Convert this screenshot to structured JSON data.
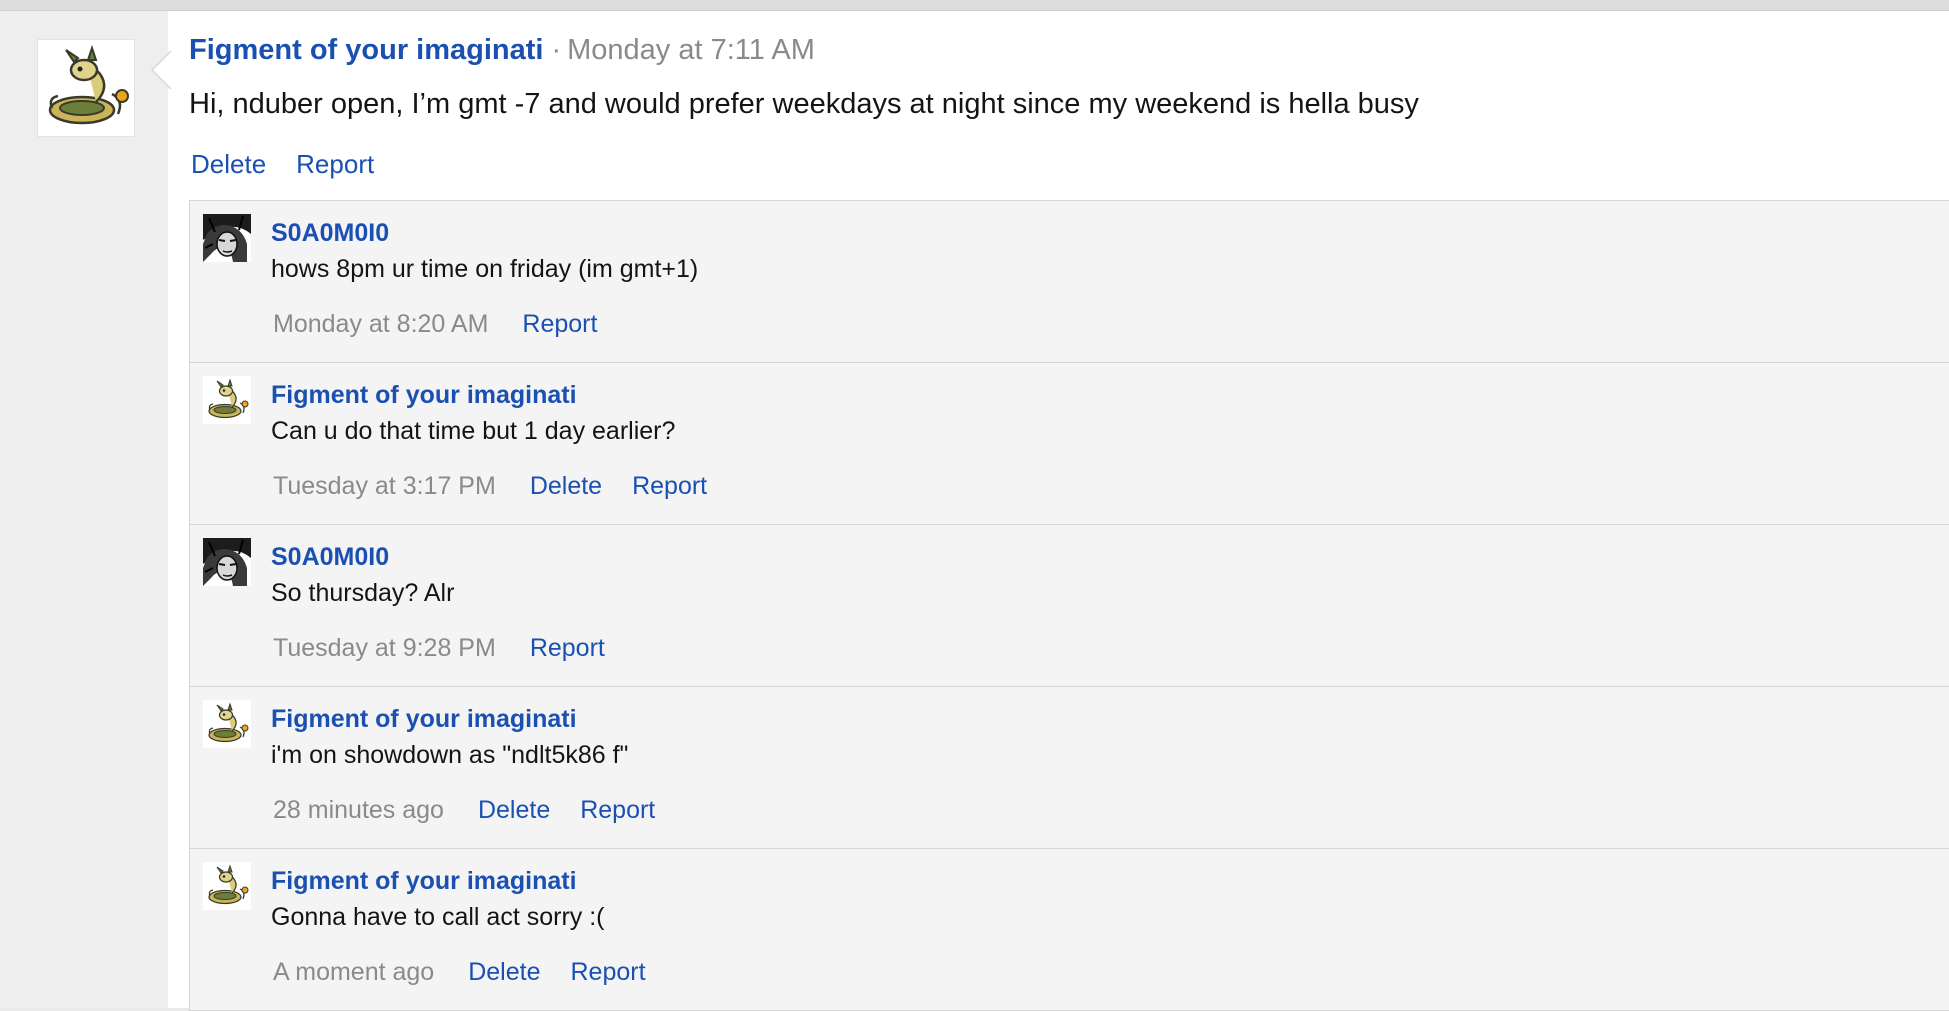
{
  "post": {
    "author": "Figment of your imaginati",
    "separator": "·",
    "time": "Monday at 7:11 AM",
    "body": "Hi, nduber open, I’m gmt -7 and would prefer weekdays at night since my weekend is hella busy",
    "actions": {
      "delete": "Delete",
      "report": "Report"
    },
    "avatar_icon": "dragonair-avatar"
  },
  "replies": [
    {
      "author": "S0A0M0I0",
      "text": "hows 8pm ur time on friday (im gmt+1)",
      "time": "Monday at 8:20 AM",
      "delete": "",
      "report": "Report",
      "avatar_icon": "sketch-face-avatar"
    },
    {
      "author": "Figment of your imaginati",
      "text": "Can u do that time but 1 day earlier?",
      "time": "Tuesday at 3:17 PM",
      "delete": "Delete",
      "report": "Report",
      "avatar_icon": "dragonair-avatar"
    },
    {
      "author": "S0A0M0I0",
      "text": "So thursday? Alr",
      "time": "Tuesday at 9:28 PM",
      "delete": "",
      "report": "Report",
      "avatar_icon": "sketch-face-avatar"
    },
    {
      "author": "Figment of your imaginati",
      "text": "i'm on showdown as \"ndlt5k86 f\"",
      "time": "28 minutes ago",
      "delete": "Delete",
      "report": "Report",
      "avatar_icon": "dragonair-avatar"
    },
    {
      "author": "Figment of your imaginati",
      "text": "Gonna have to call act sorry :(",
      "time": "A moment ago",
      "delete": "Delete",
      "report": "Report",
      "avatar_icon": "dragonair-avatar"
    }
  ],
  "colors": {
    "link": "#1b50b3",
    "muted": "#8a8a8a",
    "reply_background": "#f4f4f4",
    "page_background": "#e9e9e9"
  }
}
